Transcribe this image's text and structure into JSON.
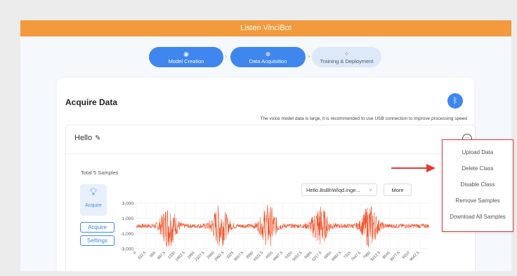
{
  "header": {
    "title": "Listen VinciBot"
  },
  "steps": [
    {
      "label": "Model Creation",
      "icon": "◉",
      "state": "active"
    },
    {
      "label": "Data Acquisition",
      "icon": "⊗",
      "state": "active"
    },
    {
      "label": "Training & Deployment",
      "icon": "⁘",
      "state": "inactive"
    }
  ],
  "card": {
    "title": "Acquire Data",
    "bluetooth_icon": "ᛒ",
    "hint": "The voice model data is large, it is recommended to use USB connection to improve processing speed"
  },
  "class_item": {
    "name": "Hello",
    "edit_icon": "✎",
    "more_icon": "···",
    "total_samples": "Total 5 Samples",
    "mode_tile_label": "Acquire",
    "acquire_button": "Acquire",
    "settings_button": "Settings",
    "sample_select": "Hello.BsBhWlqd.inge...",
    "more_button": "More"
  },
  "context_menu": {
    "items": [
      "Upload Data",
      "Delete Class",
      "Disable Class",
      "Remove Samples",
      "Download All Samples"
    ]
  },
  "chart_data": {
    "type": "line",
    "series_color": "#f0552d",
    "y_ticks": [
      "3,000",
      "1,000",
      "-1,000",
      "-3,000"
    ],
    "ylim": [
      -3000,
      3000
    ],
    "x_ticks": [
      "0",
      "332.5",
      "665",
      "997.5",
      "1330",
      "1662.5",
      "1995",
      "2327.5",
      "2660",
      "2992.5",
      "3325",
      "3657.5",
      "3990",
      "4322.5",
      "4655",
      "4987.5",
      "5320",
      "5652.5",
      "5985",
      "6317.5",
      "6650",
      "6982.5",
      "7315",
      "7647.5",
      "7980",
      "8312.5",
      "8645",
      "8977.5",
      "9310",
      "9642.5"
    ],
    "bursts_at": [
      1100,
      2850,
      4500,
      6250,
      7950
    ],
    "baseline_amplitude": 300,
    "burst_amplitude": 2700,
    "grid": true
  }
}
